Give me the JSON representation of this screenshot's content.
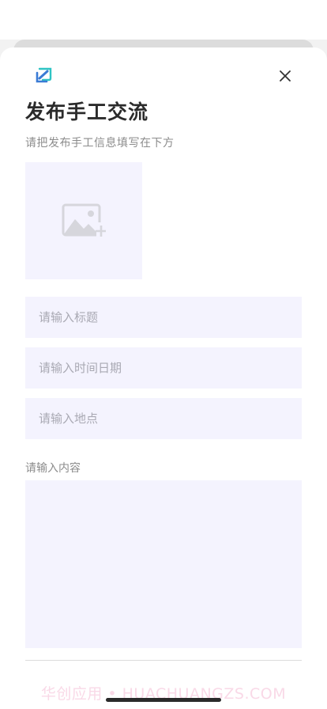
{
  "header": {
    "title": "发布手工交流",
    "subtitle": "请把发布手工信息填写在下方",
    "logo_icon": "app-logo-icon",
    "close_icon": "close-icon"
  },
  "form": {
    "image_upload_icon": "image-add-icon",
    "title_placeholder": "请输入标题",
    "datetime_placeholder": "请输入时间日期",
    "location_placeholder": "请输入地点",
    "content_label": "请输入内容",
    "content_value": ""
  },
  "footer": {
    "watermark": "华创应用 • HUACHUANGZS.COM"
  },
  "colors": {
    "field_bg": "#f4f3fe",
    "title": "#2b2b2b",
    "muted": "#8c8c8c",
    "logo_blue": "#3a7bd5",
    "logo_teal": "#2ec4c4"
  }
}
